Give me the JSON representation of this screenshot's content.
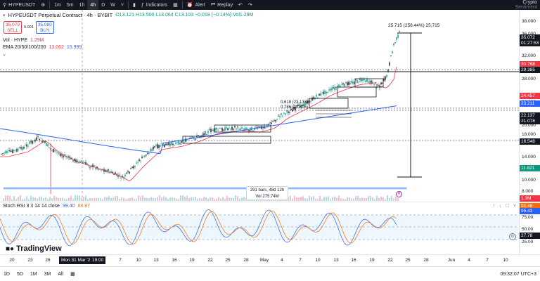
{
  "toolbar": {
    "symbol": "HYPEUSDT",
    "timeframes": [
      "1m",
      "5m",
      "1h",
      "4h",
      "D",
      "W"
    ],
    "active_timeframe": "4h",
    "indicators_label": "Indicators",
    "alert_label": "Alert",
    "replay_label": "Replay",
    "brand_line1": "Crypto",
    "brand_line2": "Sentiment"
  },
  "legend": {
    "title": "HYPEUSDT Perpetual Contract · 4h · BYBIT",
    "ohlc": "O13.121 H13.500 L13.064 C13.103 −0.018 (−0.14%) Vol1.29M",
    "sell_price": "35.079",
    "sell_label": "SELL",
    "spread": "0.001",
    "buy_price": "35.080",
    "buy_label": "BUY",
    "vol_label": "Vol · HYPE",
    "vol_value": "1.29M",
    "ema_label": "EMA 20/50/100/200",
    "ema_values": [
      "13.062",
      "15.999"
    ]
  },
  "price_axis": {
    "ticks": [
      "38.000",
      "36.000",
      "32.000",
      "28.000",
      "24.000",
      "20.000",
      "18.000",
      "14.000",
      "12.000",
      "10.000",
      "8.000"
    ],
    "labels": [
      {
        "text": "35.072",
        "sub": "01:27:53",
        "color": "#131722"
      },
      {
        "text": "30.788",
        "color": "#f23645"
      },
      {
        "text": "29.385",
        "color": "#131722"
      },
      {
        "text": "24.457",
        "color": "#f23645"
      },
      {
        "text": "23.211",
        "color": "#2962ff"
      },
      {
        "text": "22.137",
        "color": "#131722"
      },
      {
        "text": "21.078",
        "color": "#131722"
      },
      {
        "text": "16.548",
        "color": "#131722"
      },
      {
        "text": "11.821",
        "color": "#089981"
      },
      {
        "text": "1.3M",
        "color": "#f23645"
      }
    ]
  },
  "annotations": {
    "range_label": "25.715 (258.44%) 25,715",
    "fib_0618": "0.618 (23.137)",
    "fib_0786": "0.786 (22.405)",
    "bars_label": "291 bars, 48d 12h",
    "vol_label": "Vol 275.74M"
  },
  "rsi": {
    "legend": "Stoch RSI 3 3 14 14 close",
    "k_value": "99.40",
    "d_value": "88.87",
    "ticks": [
      "75.00",
      "50.00",
      "25.00"
    ],
    "label_k": "98.48",
    "label_d": "95.43",
    "label_low": "27.78"
  },
  "time_axis": {
    "ticks": [
      "20",
      "23",
      "26",
      "Mon 31 Mar '25",
      "19:00",
      "7",
      "10",
      "13",
      "16",
      "19",
      "22",
      "25",
      "28",
      "May",
      "4",
      "7",
      "10",
      "13",
      "16",
      "19",
      "22",
      "25",
      "28",
      "Jun",
      "4",
      "7",
      "10"
    ]
  },
  "bottombar": {
    "ranges": [
      "1D",
      "5D",
      "1M",
      "3M",
      "All"
    ],
    "clock": "09:32:07 UTC+3"
  },
  "watermark": "TradingView",
  "colors": {
    "up": "#089981",
    "down": "#131722",
    "ema_red": "#f23645",
    "ema_blue": "#2962ff",
    "rsi_k": "#2962ff",
    "rsi_d": "#ff6d00"
  }
}
